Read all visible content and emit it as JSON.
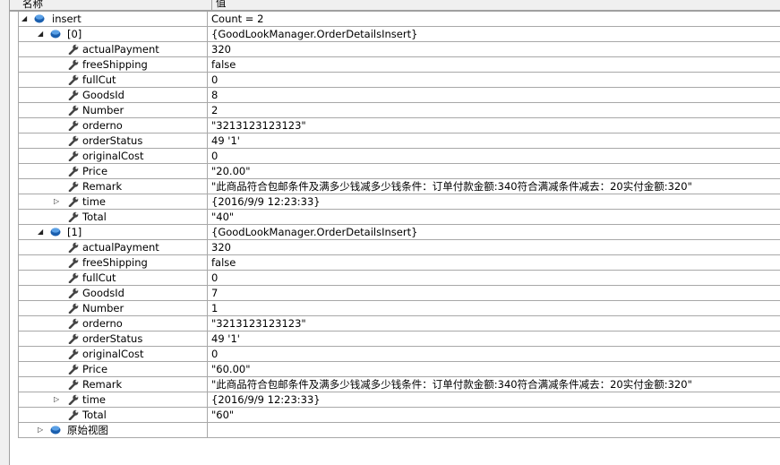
{
  "header": {
    "name_col": "名称",
    "value_col": "值"
  },
  "rows": [
    {
      "level": 0,
      "expander": "expanded",
      "icon": "object-icon",
      "name": "insert",
      "value": "Count = 2"
    },
    {
      "level": 1,
      "expander": "expanded",
      "icon": "object-icon",
      "name": "[0]",
      "value": "{GoodLookManager.OrderDetailsInsert}"
    },
    {
      "level": 2,
      "expander": "none",
      "icon": "property-wrench-icon",
      "name": "actualPayment",
      "value": "320"
    },
    {
      "level": 2,
      "expander": "none",
      "icon": "property-wrench-icon",
      "name": "freeShipping",
      "value": "false"
    },
    {
      "level": 2,
      "expander": "none",
      "icon": "property-wrench-icon",
      "name": "fullCut",
      "value": "0"
    },
    {
      "level": 2,
      "expander": "none",
      "icon": "property-wrench-icon",
      "name": "GoodsId",
      "value": "8"
    },
    {
      "level": 2,
      "expander": "none",
      "icon": "property-wrench-icon",
      "name": "Number",
      "value": "2"
    },
    {
      "level": 2,
      "expander": "none",
      "icon": "property-wrench-icon",
      "name": "orderno",
      "value": "\"3213123123123\""
    },
    {
      "level": 2,
      "expander": "none",
      "icon": "property-wrench-icon",
      "name": "orderStatus",
      "value": "49 '1'"
    },
    {
      "level": 2,
      "expander": "none",
      "icon": "property-wrench-icon",
      "name": "originalCost",
      "value": "0"
    },
    {
      "level": 2,
      "expander": "none",
      "icon": "property-wrench-icon",
      "name": "Price",
      "value": "\"20.00\""
    },
    {
      "level": 2,
      "expander": "none",
      "icon": "property-wrench-icon",
      "name": "Remark",
      "value": "\"此商品符合包邮条件及满多少钱减多少钱条件：订单付款金额:340符合满减条件减去：20实付金额:320\""
    },
    {
      "level": 2,
      "expander": "collapsed",
      "icon": "property-wrench-icon",
      "name": "time",
      "value": "{2016/9/9 12:23:33}"
    },
    {
      "level": 2,
      "expander": "none",
      "icon": "property-wrench-icon",
      "name": "Total",
      "value": "\"40\""
    },
    {
      "level": 1,
      "expander": "expanded",
      "icon": "object-icon",
      "name": "[1]",
      "value": "{GoodLookManager.OrderDetailsInsert}"
    },
    {
      "level": 2,
      "expander": "none",
      "icon": "property-wrench-icon",
      "name": "actualPayment",
      "value": "320"
    },
    {
      "level": 2,
      "expander": "none",
      "icon": "property-wrench-icon",
      "name": "freeShipping",
      "value": "false"
    },
    {
      "level": 2,
      "expander": "none",
      "icon": "property-wrench-icon",
      "name": "fullCut",
      "value": "0"
    },
    {
      "level": 2,
      "expander": "none",
      "icon": "property-wrench-icon",
      "name": "GoodsId",
      "value": "7"
    },
    {
      "level": 2,
      "expander": "none",
      "icon": "property-wrench-icon",
      "name": "Number",
      "value": "1"
    },
    {
      "level": 2,
      "expander": "none",
      "icon": "property-wrench-icon",
      "name": "orderno",
      "value": "\"3213123123123\""
    },
    {
      "level": 2,
      "expander": "none",
      "icon": "property-wrench-icon",
      "name": "orderStatus",
      "value": "49 '1'"
    },
    {
      "level": 2,
      "expander": "none",
      "icon": "property-wrench-icon",
      "name": "originalCost",
      "value": "0"
    },
    {
      "level": 2,
      "expander": "none",
      "icon": "property-wrench-icon",
      "name": "Price",
      "value": "\"60.00\""
    },
    {
      "level": 2,
      "expander": "none",
      "icon": "property-wrench-icon",
      "name": "Remark",
      "value": "\"此商品符合包邮条件及满多少钱减多少钱条件：订单付款金额:340符合满减条件减去：20实付金额:320\""
    },
    {
      "level": 2,
      "expander": "collapsed",
      "icon": "property-wrench-icon",
      "name": "time",
      "value": "{2016/9/9 12:23:33}"
    },
    {
      "level": 2,
      "expander": "none",
      "icon": "property-wrench-icon",
      "name": "Total",
      "value": "\"60\""
    },
    {
      "level": 1,
      "expander": "collapsed",
      "icon": "object-icon",
      "name": "原始视图",
      "value": ""
    }
  ]
}
